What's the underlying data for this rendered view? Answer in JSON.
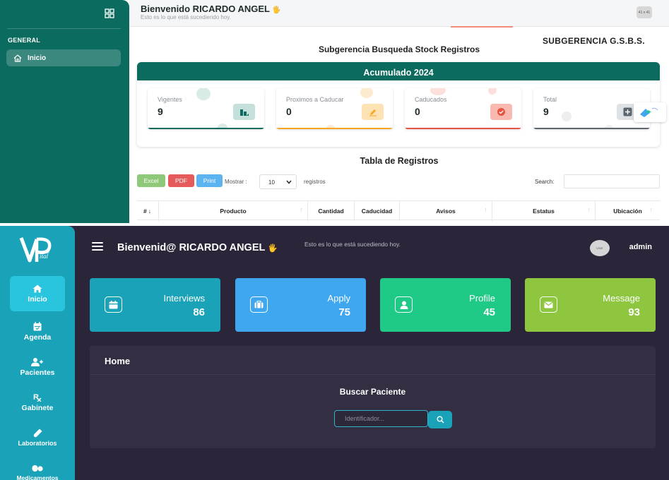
{
  "admin_panel": {
    "sidebar": {
      "section": "GENERAL",
      "items": [
        {
          "label": "Inicio",
          "active": true,
          "icon": "home-icon"
        }
      ]
    },
    "header": {
      "welcome": "Bienvenido RICARDO ANGEL",
      "welcome_emoji": "🖐",
      "subtitle": "Esto es lo que está sucediendo hoy.",
      "avatar_text": "41 x 41"
    },
    "org_title": "SUBGERENCIA G.S.B.S.",
    "page_title": "Subgerencia Busqueda Stock Registros",
    "summary": {
      "title": "Acumulado 2024",
      "cards": [
        {
          "label": "Vigentes",
          "value": "9",
          "color": "#0b6b5e",
          "icon": "bar-chart-icon"
        },
        {
          "label": "Proximos a Caducar",
          "value": "0",
          "color": "#f5a623",
          "icon": "pencil-icon"
        },
        {
          "label": "Caducados",
          "value": "0",
          "color": "#e8533f",
          "icon": "check-circle-icon"
        },
        {
          "label": "Total",
          "value": "9",
          "color": "#5b6670",
          "icon": "plus-icon"
        }
      ]
    },
    "table": {
      "title": "Tabla de Registros",
      "buttons": {
        "excel": "Excel",
        "pdf": "PDF",
        "print": "Print"
      },
      "show_label": "Mostrar :",
      "page_size": "10",
      "records_label": "registros",
      "search_label": "Search:",
      "columns": [
        "#",
        "Producto",
        "Cantidad",
        "Caducidad",
        "Avisos",
        "Estatus",
        "Ubicación"
      ]
    }
  },
  "patient_app": {
    "sidebar": {
      "items": [
        {
          "label": "Inicio",
          "active": true,
          "icon": "home-icon"
        },
        {
          "label": "Agenda",
          "active": false,
          "icon": "calendar-icon"
        },
        {
          "label": "Pacientes",
          "active": false,
          "icon": "add-user-icon"
        },
        {
          "label": "Gabinete",
          "active": false,
          "icon": "prescription-icon"
        },
        {
          "label": "Laboratorios",
          "active": false,
          "icon": "test-tube-icon"
        },
        {
          "label": "Medicamentos",
          "active": false,
          "icon": "pills-icon"
        }
      ]
    },
    "header": {
      "welcome": "Bienvenid@ RICARDO ANGEL",
      "welcome_emoji": "🖐",
      "subtitle": "Esto es lo que está sucediendo hoy.",
      "avatar_text": "User",
      "user": "admin"
    },
    "tiles": [
      {
        "label": "Interviews",
        "value": "86",
        "color": "#1aa3b8",
        "icon": "calendar-icon"
      },
      {
        "label": "Apply",
        "value": "75",
        "color": "#3fa6f0",
        "icon": "briefcase-icon"
      },
      {
        "label": "Profile",
        "value": "45",
        "color": "#1fc986",
        "icon": "user-icon"
      },
      {
        "label": "Message",
        "value": "93",
        "color": "#8ec63f",
        "icon": "envelope-icon"
      }
    ],
    "home": {
      "title": "Home",
      "search_title": "Buscar Paciente",
      "input_placeholder": "Identificador..."
    }
  }
}
